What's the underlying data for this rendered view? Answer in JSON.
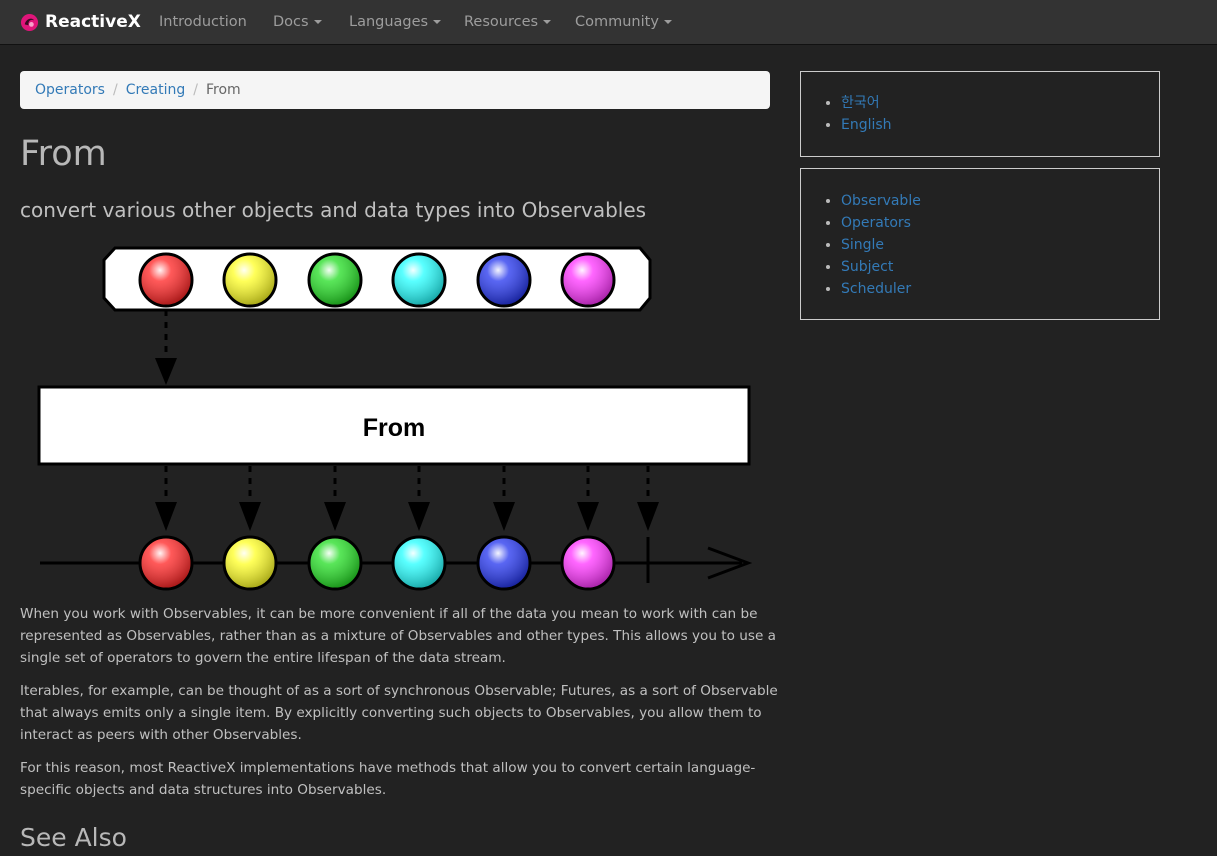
{
  "navbar": {
    "brand": "ReactiveX",
    "items": [
      {
        "label": "Introduction"
      },
      {
        "label": "Docs"
      },
      {
        "label": "Languages"
      },
      {
        "label": "Resources"
      },
      {
        "label": "Community"
      }
    ]
  },
  "breadcrumb": {
    "items": [
      "Operators",
      "Creating"
    ],
    "current": "From"
  },
  "page": {
    "title": "From",
    "subtitle": "convert various other objects and data types into Observables"
  },
  "diagram": {
    "operator_label": "From",
    "marble_colors": [
      "#ff2222",
      "#ffff22",
      "#22dd22",
      "#22ffff",
      "#2233ee",
      "#ff33ff"
    ]
  },
  "paragraphs": [
    "When you work with Observables, it can be more convenient if all of the data you mean to work with can be represented as Observables, rather than as a mixture of Observables and other types. This allows you to use a single set of operators to govern the entire lifespan of the data stream.",
    "Iterables, for example, can be thought of as a sort of synchronous Observable; Futures, as a sort of Observable that always emits only a single item. By explicitly converting such objects to Observables, you allow them to interact as peers with other Observables.",
    "For this reason, most ReactiveX implementations have methods that allow you to convert certain language-specific objects and data structures into Observables."
  ],
  "see_also": "See Also",
  "sidebar": {
    "languages": [
      "한국어",
      "English"
    ],
    "links": [
      "Observable",
      "Operators",
      "Single",
      "Subject",
      "Scheduler"
    ]
  },
  "colors": {
    "background": "#222222",
    "navbar": "#333333",
    "link": "#337ab7",
    "logo": "#e0157a"
  }
}
